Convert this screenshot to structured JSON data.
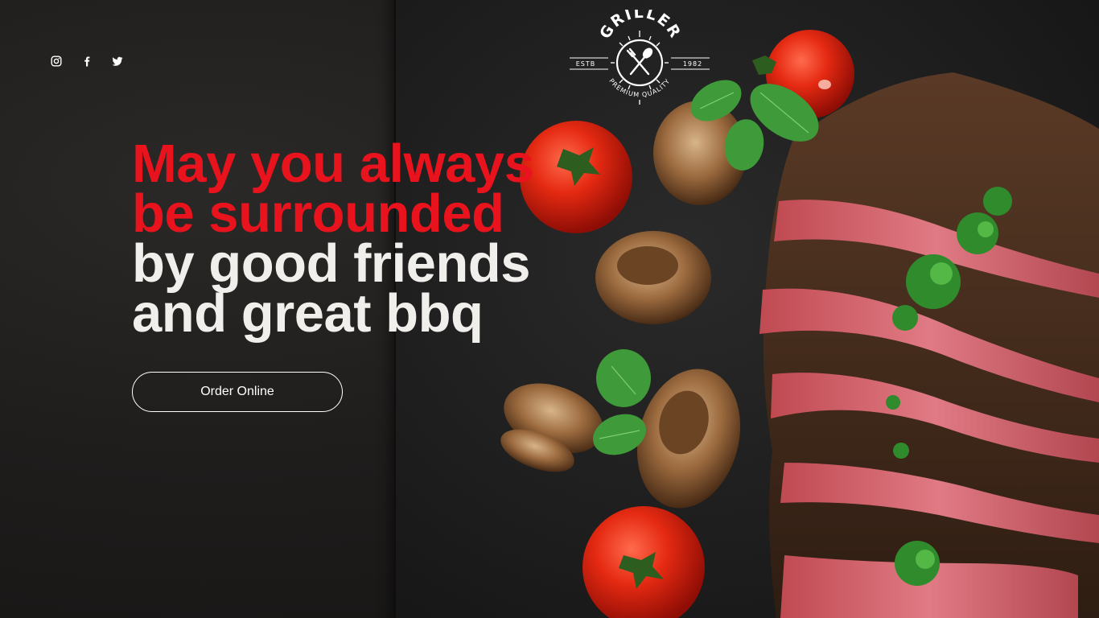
{
  "social": {
    "items": [
      {
        "name": "instagram",
        "icon": "instagram-icon"
      },
      {
        "name": "facebook",
        "icon": "facebook-icon"
      },
      {
        "name": "twitter",
        "icon": "twitter-icon"
      }
    ]
  },
  "logo": {
    "brand": "GRILLER",
    "estb_label": "ESTB",
    "year": "1982",
    "tagline": "PREMIUM QUALITY",
    "icon": "fork-spoon-icon"
  },
  "hero": {
    "headline_line_1": "May you always",
    "headline_line_2": "be surrounded",
    "headline_line_3": "by good friends",
    "headline_line_4": "and great bbq",
    "cta_label": "Order Online"
  },
  "colors": {
    "accent_red": "#e8131c",
    "headline_white": "#f1efec",
    "background": "#1a1918"
  }
}
